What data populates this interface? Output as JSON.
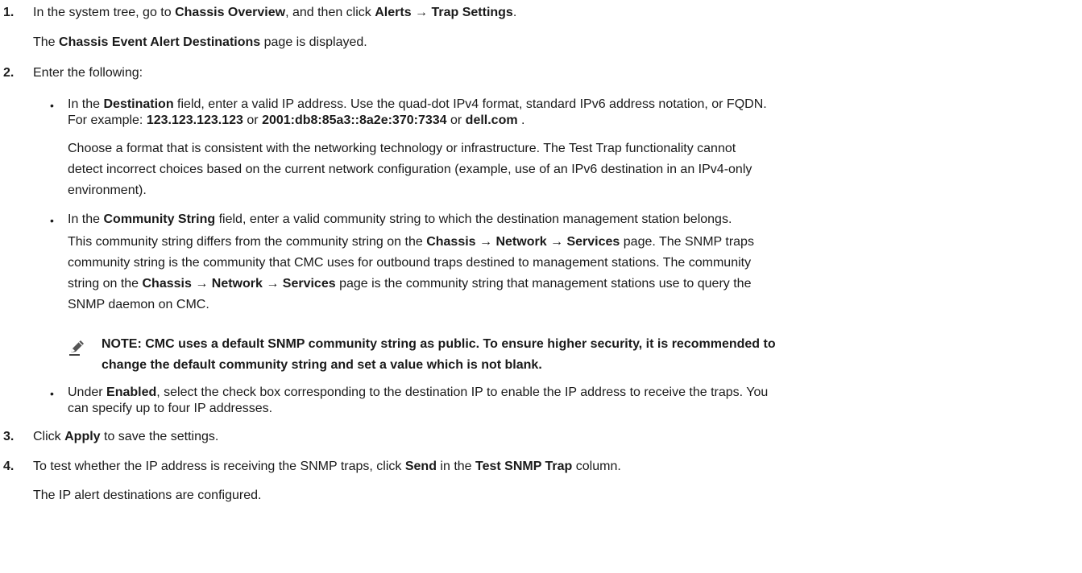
{
  "step1": {
    "num": "1.",
    "t1": "In the system tree, go to ",
    "b1": "Chassis Overview",
    "t2": ", and then click ",
    "b2": "Alerts → Trap Settings",
    "t3": ".",
    "r1": "The ",
    "rb": "Chassis Event Alert Destinations",
    "r2": " page is displayed."
  },
  "step2": {
    "num": "2.",
    "text": "Enter the following:",
    "dest": {
      "t1": "In the ",
      "b1": "Destination",
      "t2": " field, enter a valid IP address. Use the quad-dot IPv4 format, standard IPv6 address notation, or FQDN.",
      "e1": "For example: ",
      "eb1": "123.123.123.123",
      "e2": " or ",
      "eb2": "2001:db8:85a3::8a2e:370:7334",
      "e3": " or ",
      "eb3": "dell.com",
      "e4": " .",
      "p1": "Choose a format that is consistent with the networking technology or infrastructure. The Test Trap functionality cannot",
      "p2": "detect incorrect choices based on the current network configuration (example, use of an IPv6 destination in an IPv4-only",
      "p3": "environment)."
    },
    "community": {
      "t1": "In the ",
      "b1": "Community String",
      "t2": " field, enter a valid community string to which the destination management station belongs.",
      "a1": "This community string differs from the community string on the ",
      "ab1": "Chassis",
      "arrow": " → ",
      "ab2": "Network",
      "ab3": "Services",
      "a2": " page. The SNMP traps",
      "l2": "community string is the community that CMC uses for outbound traps destined to management stations. The community",
      "l3a": "string on the ",
      "l3b": " page is the community string that management stations use to query the",
      "l4": "SNMP daemon on CMC."
    },
    "note": {
      "l1": "NOTE: CMC uses a default SNMP community string as public. To ensure higher security, it is recommended to",
      "l2": "change the default community string and set a value which is not blank."
    },
    "enabled": {
      "t1": "Under ",
      "b1": "Enabled",
      "t2": ", select the check box corresponding to the destination IP to enable the IP address to receive the traps. You",
      "l2": "can specify up to four IP addresses."
    }
  },
  "step3": {
    "num": "3.",
    "t1": "Click ",
    "b1": "Apply",
    "t2": " to save the settings."
  },
  "step4": {
    "num": "4.",
    "t1": "To test whether the IP address is receiving the SNMP traps, click ",
    "b1": "Send",
    "t2": " in the ",
    "b2": "Test SNMP Trap",
    "t3": " column.",
    "r1": "The IP alert destinations are configured."
  }
}
